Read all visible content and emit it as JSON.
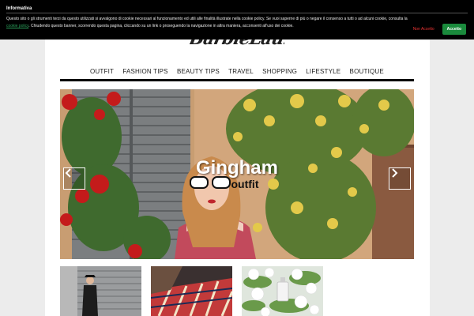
{
  "cookie": {
    "title": "Informativa",
    "text_before_link": "Questo sito o gli strumenti terzi da questo utilizzati si avvalgono di cookie necessari al funzionamento ed utili alle finalità illustrate nella cookie policy. Se vuoi saperne di più o negare il consenso a tutti o ad alcuni cookie, consulta la ",
    "link_text": "cookie policy",
    "text_after_link": ". Chiudendo questo banner, scorrendo questa pagina, cliccando su un link o proseguendo la navigazione in altra maniera, acconsenti all'uso dei cookie.",
    "refuse_label": "Non Accetto",
    "accept_label": "Accetto",
    "accent_color": "#1a8a3c",
    "refuse_color": "#e33333"
  },
  "logo": {
    "text": "BarbieLaura"
  },
  "nav": {
    "items": [
      "OUTFIT",
      "FASHION TIPS",
      "BEAUTY TIPS",
      "TRAVEL",
      "SHOPPING",
      "LIFESTYLE",
      "BOUTIQUE"
    ]
  },
  "slider": {
    "title": "Gingham",
    "subtitle": "outfit",
    "prev_icon": "chevron-left-icon",
    "next_icon": "chevron-right-icon"
  },
  "thumbnails": [
    {
      "name": "thumbnail-street-outfit"
    },
    {
      "name": "thumbnail-plaid-fabric"
    },
    {
      "name": "thumbnail-white-flowers-perfume"
    }
  ]
}
